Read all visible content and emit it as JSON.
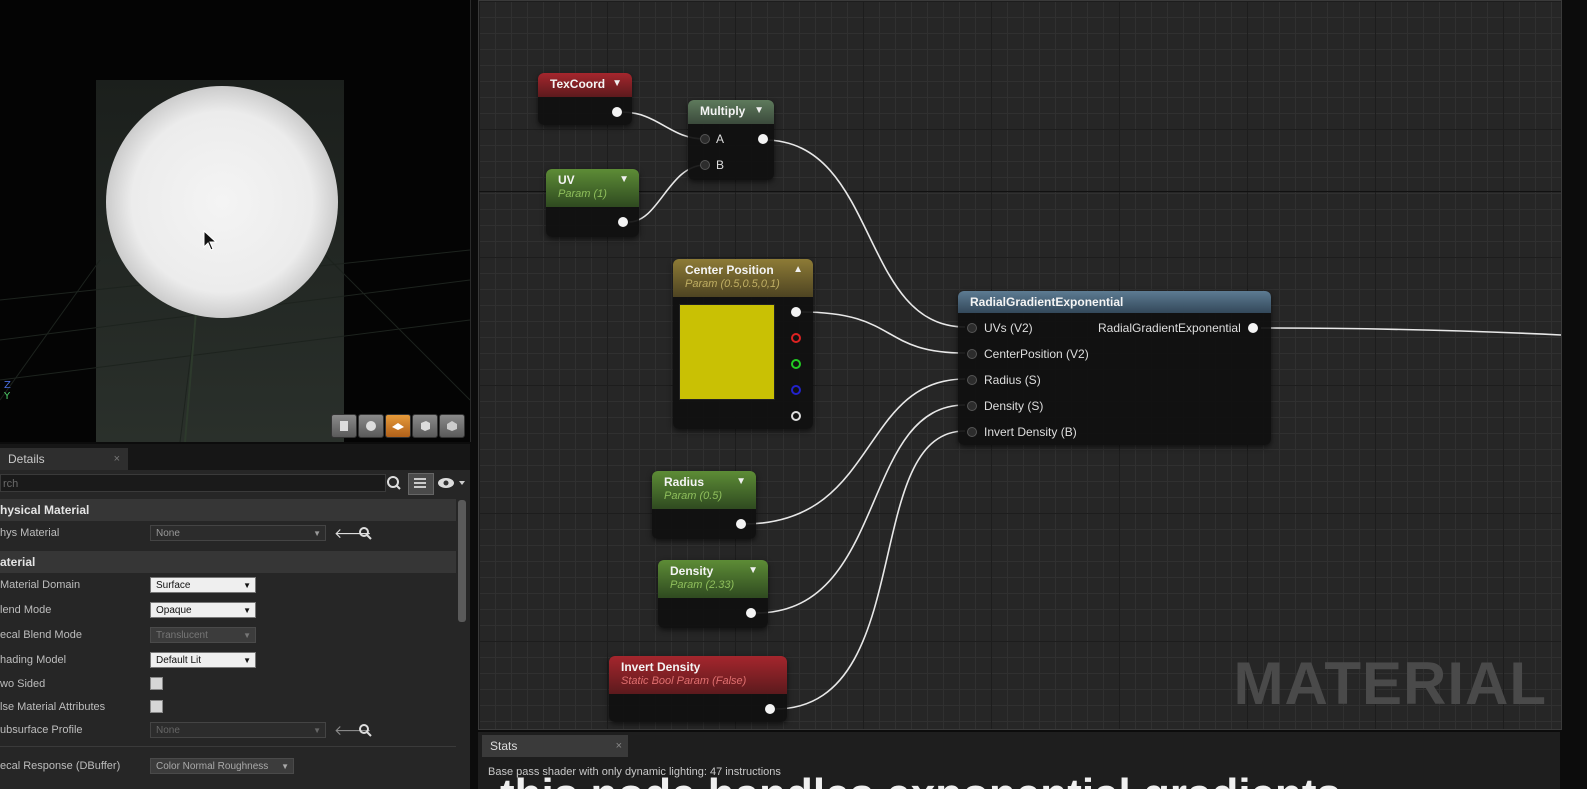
{
  "viewport": {
    "axis_z": "Z",
    "axis_y": "Y",
    "buttons": [
      "cylinder-icon",
      "sphere-icon",
      "plane-icon",
      "cube-icon",
      "mesh-icon"
    ]
  },
  "details": {
    "tab_label": "Details",
    "tab_close": "×",
    "search_placeholder": "rch",
    "sections": {
      "physical_material": "hysical Material",
      "material": "aterial"
    },
    "rows": {
      "phys_material": {
        "label": "hys Material",
        "value": "None"
      },
      "material_domain": {
        "label": "Material Domain",
        "value": "Surface"
      },
      "blend_mode": {
        "label": "lend Mode",
        "value": "Opaque"
      },
      "decal_blend_mode": {
        "label": "ecal Blend Mode",
        "value": "Translucent"
      },
      "shading_model": {
        "label": "hading Model",
        "value": "Default Lit"
      },
      "two_sided": {
        "label": "wo Sided"
      },
      "use_material_attributes": {
        "label": "lse Material Attributes"
      },
      "subsurface_profile": {
        "label": "ubsurface Profile",
        "value": "None"
      },
      "decal_response": {
        "label": "ecal Response (DBuffer)",
        "value": "Color Normal Roughness"
      }
    }
  },
  "graph": {
    "nodes": {
      "texcoord": {
        "title": "TexCoord"
      },
      "multiply": {
        "title": "Multiply",
        "pin_a": "A",
        "pin_b": "B"
      },
      "uv": {
        "title": "UV",
        "sub": "Param (1)"
      },
      "center_position": {
        "title": "Center Position",
        "sub": "Param (0.5,0.5,0,1)",
        "swatch_color": "#c9c104"
      },
      "radial": {
        "title": "RadialGradientExponential",
        "inputs": [
          "UVs (V2)",
          "CenterPosition (V2)",
          "Radius (S)",
          "Density (S)",
          "Invert Density (B)"
        ],
        "output": "RadialGradientExponential"
      },
      "radius": {
        "title": "Radius",
        "sub": "Param (0.5)"
      },
      "density": {
        "title": "Density",
        "sub": "Param (2.33)"
      },
      "invert_density": {
        "title": "Invert Density",
        "sub": "Static Bool Param (False)"
      }
    },
    "watermark": "MATERIAL"
  },
  "stats": {
    "tab_label": "Stats",
    "tab_close": "×",
    "text": "Base pass shader with only dynamic lighting: 47 instructions"
  },
  "caption": "this node handles exponential gradients"
}
